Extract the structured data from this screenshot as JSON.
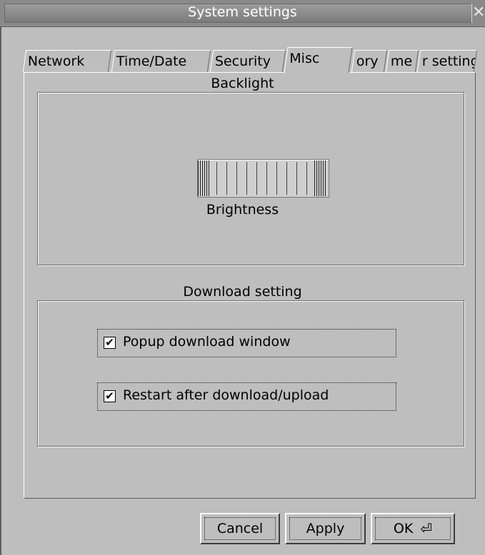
{
  "window": {
    "title": "System settings",
    "close_icon": "close-x-icon"
  },
  "tabs": [
    {
      "label": "Network"
    },
    {
      "label": "Time/Date"
    },
    {
      "label": "Security"
    },
    {
      "label": "Misc"
    },
    {
      "label": "ory"
    },
    {
      "label": "me"
    },
    {
      "label": "r setting"
    }
  ],
  "active_tab": "Misc",
  "backlight": {
    "group_title": "Backlight",
    "slider_label": "Brightness"
  },
  "download": {
    "group_title": "Download setting",
    "options": [
      {
        "label": "Popup download window",
        "checked": true
      },
      {
        "label": "Restart after download/upload",
        "checked": true
      }
    ]
  },
  "buttons": {
    "cancel": "Cancel",
    "apply": "Apply",
    "ok": "OK",
    "ok_icon": "enter-return-icon"
  }
}
